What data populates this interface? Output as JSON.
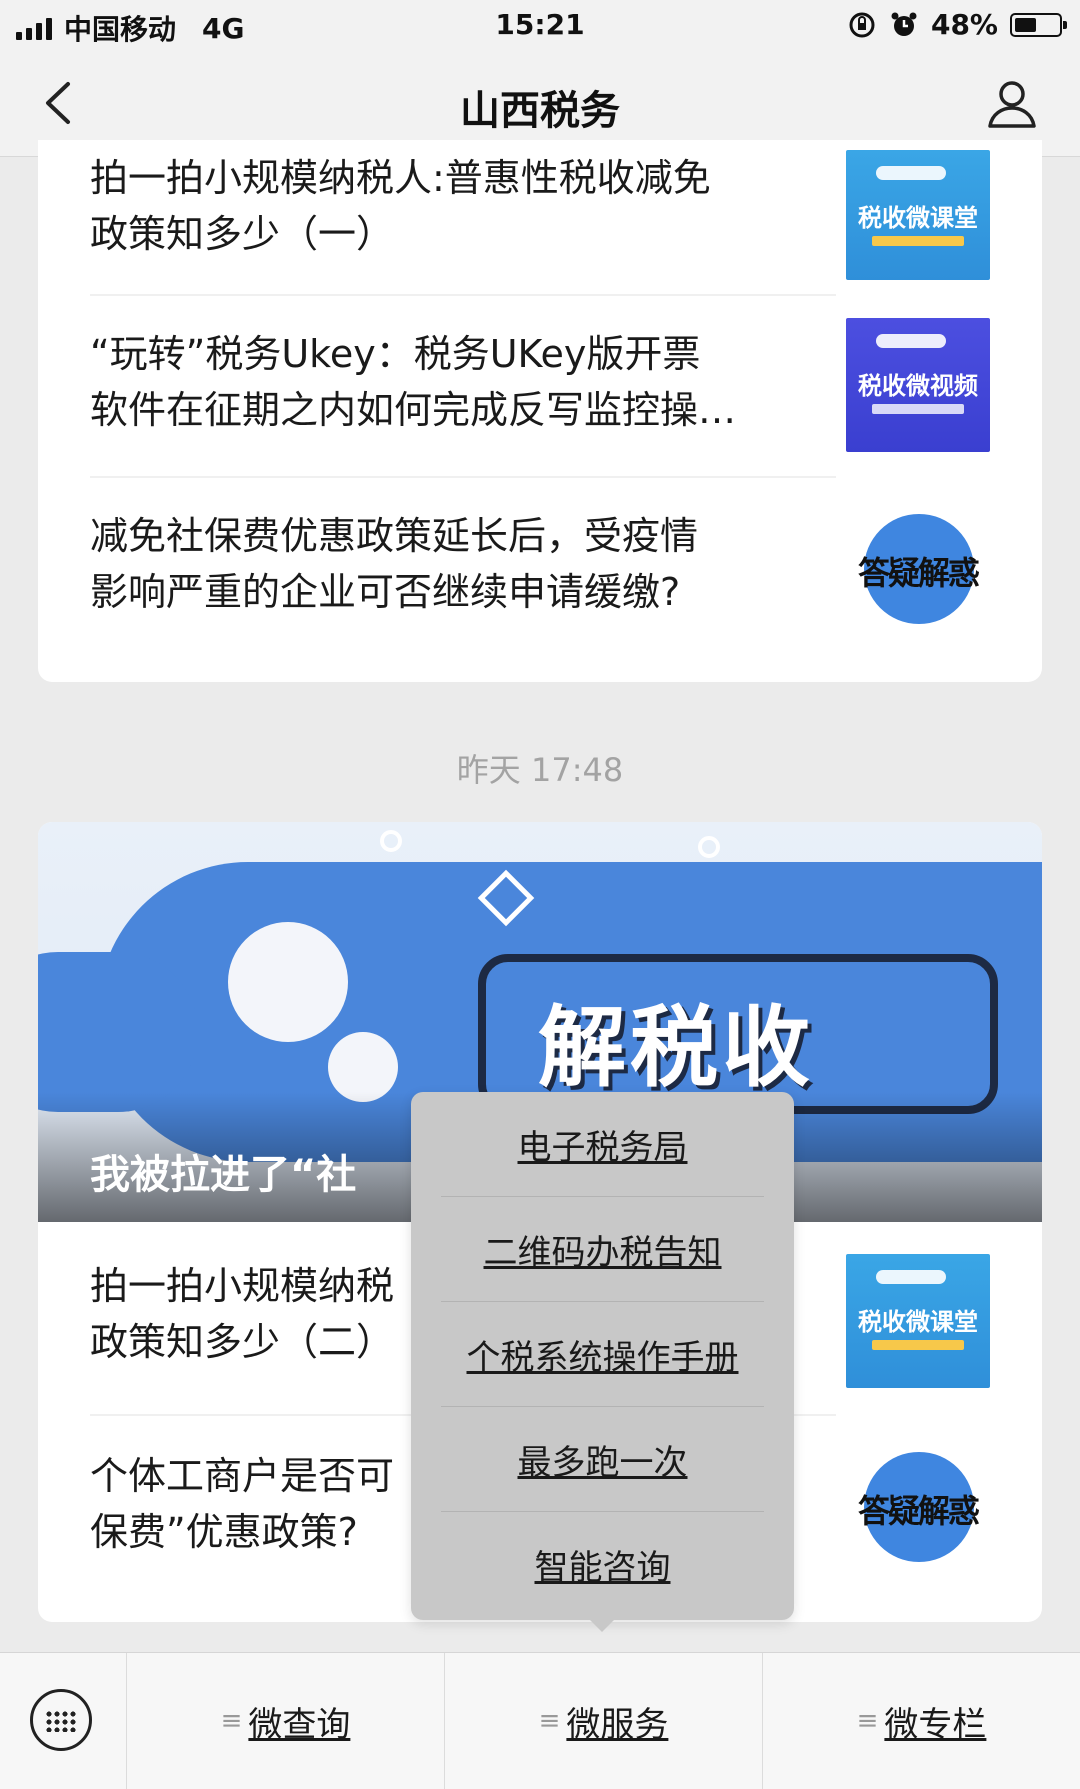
{
  "status_bar": {
    "carrier": "中国移动",
    "network": "4G",
    "time": "15:21",
    "battery": "48%",
    "battery_level": 0.48
  },
  "nav": {
    "title": "山西税务",
    "back_icon": "chevron-left-icon",
    "profile_icon": "person-icon"
  },
  "articles_top": [
    {
      "title": "拍一拍小规模纳税人:普惠性税收减免\n政策知多少（一）",
      "thumb_text": "税收微课堂"
    },
    {
      "title": "“玩转”税务Ukey：税务UKey版开票\n软件在征期之内如何完成反写监控操…",
      "thumb_text": "税收微视频"
    },
    {
      "title": "减免社保费优惠政策延长后，受疫情\n影响严重的企业可否继续申请缓缴?",
      "thumb_text": "答疑解惑"
    }
  ],
  "timestamp": "昨天 17:48",
  "banner": {
    "headline": "解税收",
    "caption": "我被拉进了“社"
  },
  "articles_bottom": [
    {
      "title": "拍一拍小规模纳税\n政策知多少（二）",
      "thumb_text": "税收微课堂"
    },
    {
      "title": "个体工商户是否可\n保费”优惠政策?",
      "thumb_text": "答疑解惑"
    }
  ],
  "popup_menu": {
    "items": [
      "电子税务局",
      "二维码办税告知",
      "个税系统操作手册",
      "最多跑一次",
      "智能咨询"
    ]
  },
  "bottom_menu": {
    "keyboard_icon": "keyboard-icon",
    "items": [
      "微查询",
      "微服务",
      "微专栏"
    ]
  },
  "colors": {
    "background": "#ebebeb",
    "popup": "#c8c8c8",
    "accent_blue": "#4a86db"
  }
}
